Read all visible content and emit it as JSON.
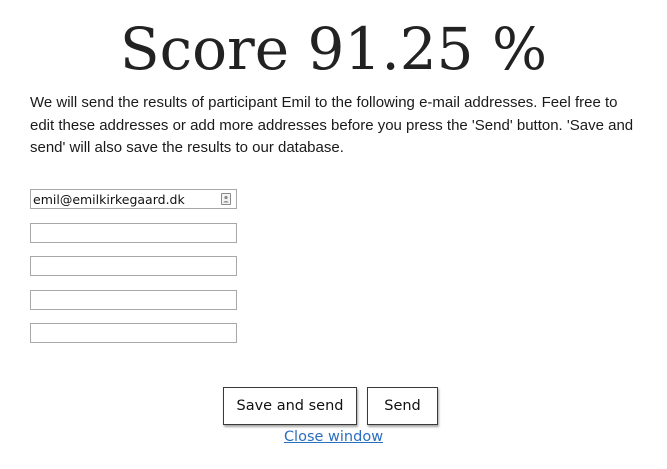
{
  "score": {
    "title": "Score 91.25 %"
  },
  "intro_text": "We will send the results of participant Emil to the following e-mail addresses. Feel free to edit these addresses or add more addresses before you press the 'Send' button. 'Save and send' will also save the results to our database.",
  "emails": [
    "emil@emilkirkegaard.dk",
    "",
    "",
    "",
    ""
  ],
  "buttons": {
    "save_and_send": "Save and send",
    "send": "Send"
  },
  "close_link": "Close window",
  "colors": {
    "link": "#2a6fbe",
    "field_border": "#a8a8a8",
    "button_border": "#3a3a3a"
  },
  "icons": {
    "contact_autofill": "contact-card-icon"
  }
}
